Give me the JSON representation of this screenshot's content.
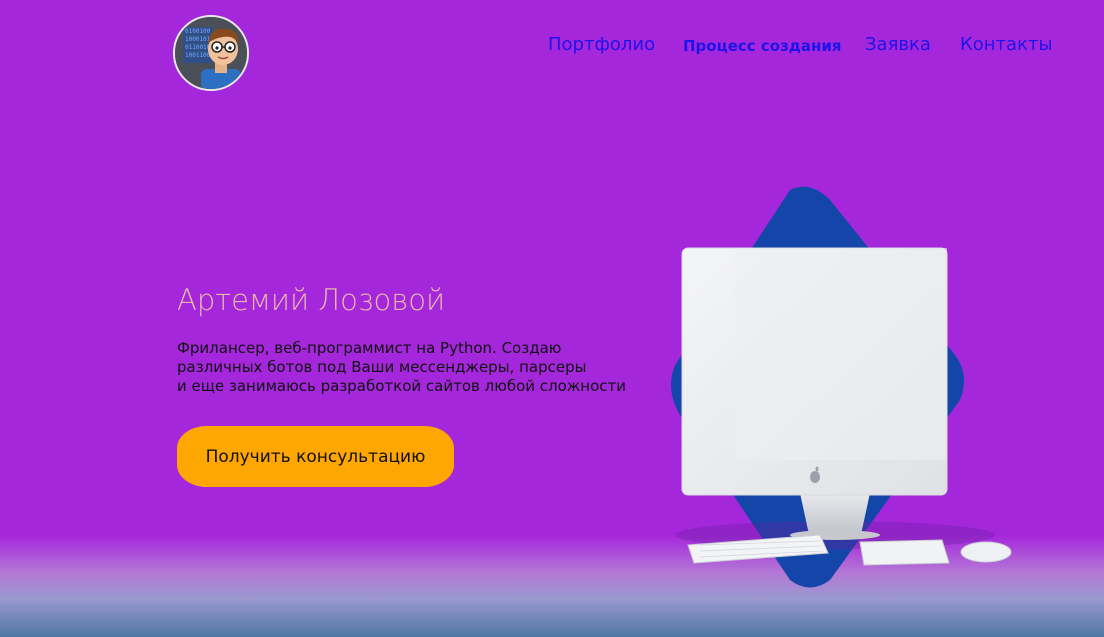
{
  "header": {
    "logo_icon": "developer-avatar",
    "nav": [
      {
        "label": "Портфолио",
        "active": false
      },
      {
        "label": "Процесс создания",
        "active": true
      },
      {
        "label": "Заявка",
        "active": false
      },
      {
        "label": "Контакты",
        "active": false
      }
    ]
  },
  "hero": {
    "title": "Артемий Лозовой",
    "description_lines": [
      "Фрилансер, веб-программист на Python. Создаю",
      "различных ботов под Ваши мессенджеры, парсеры",
      "и еще занимаюсь разработкой сайтов любой сложности"
    ],
    "cta_label": "Получить консультацию"
  },
  "illustration": {
    "icon": "desktop-computer-illustration",
    "colors": {
      "diamond": "#1446a9",
      "screen": "#eef0f3",
      "cta": "#fea601",
      "nav_link": "#1f14e8",
      "title": "#e8b9a6"
    }
  }
}
